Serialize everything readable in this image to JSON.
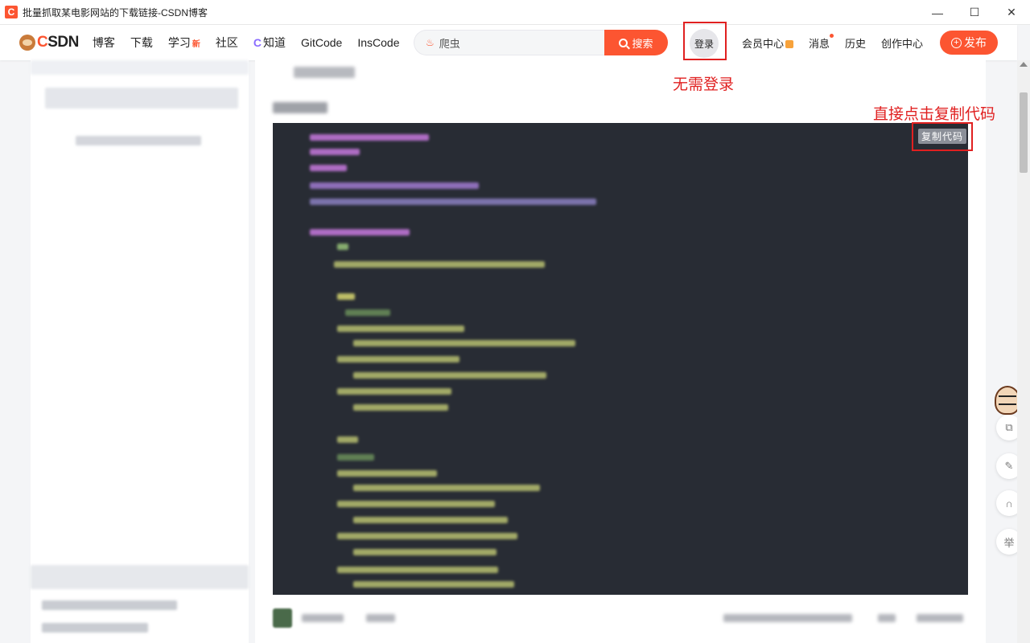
{
  "window": {
    "title": "批量抓取某电影网站的下载链接-CSDN博客",
    "app_icon": "C",
    "controls": [
      "—",
      "☐",
      "✕"
    ]
  },
  "nav": {
    "logo_text_c": "C",
    "logo_text_rest": "SDN",
    "links": [
      "博客",
      "下载",
      "学习",
      "社区",
      "知道",
      "GitCode",
      "InsCode"
    ],
    "new_badge": "新",
    "search_placeholder": "爬虫",
    "search_button": "搜索",
    "login": "登录",
    "right_links": [
      "会员中心",
      "消息",
      "历史",
      "创作中心"
    ],
    "publish": "发布"
  },
  "code": {
    "copy_button": "复制代码"
  },
  "annotations": {
    "login_note": "无需登录",
    "copy_note": "直接点击复制代码"
  },
  "rail": {
    "last_tool": "举"
  },
  "colors": {
    "accent": "#fc5531",
    "annotation": "#e02020",
    "code_bg": "#282c34"
  }
}
